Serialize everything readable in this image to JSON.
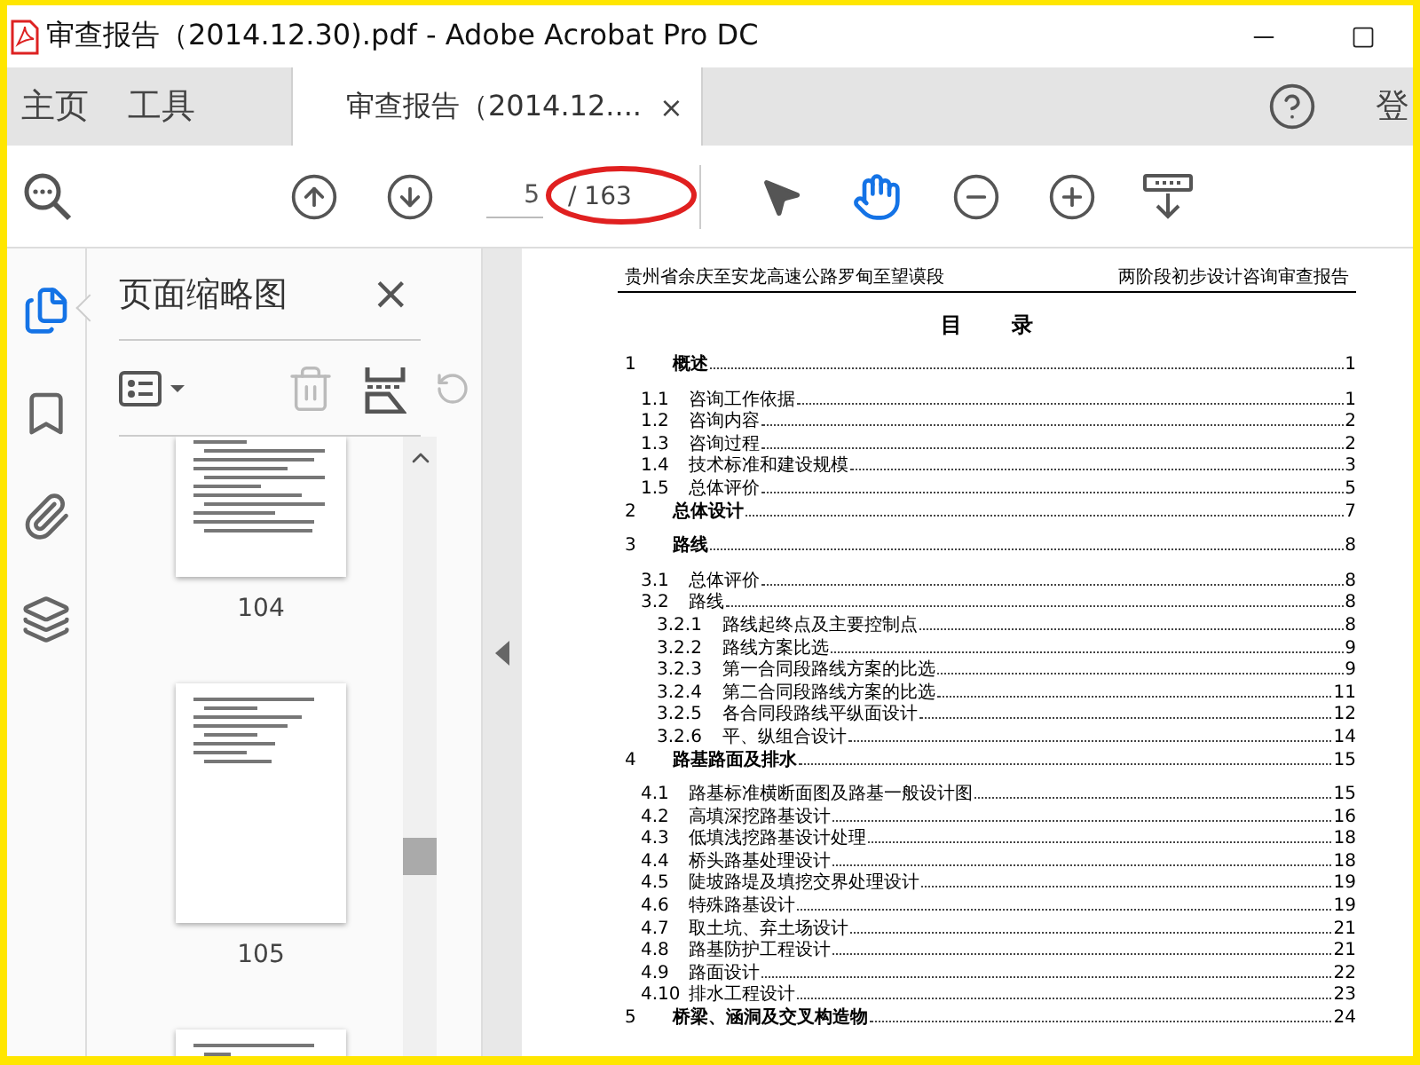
{
  "window": {
    "title": "审查报告（2014.12.30).pdf - Adobe Acrobat Pro DC"
  },
  "tabs": [
    {
      "label": "主页",
      "selected": false
    },
    {
      "label": "工具",
      "selected": false
    },
    {
      "label": "审查报告（2014.12....",
      "selected": true,
      "close": "×"
    }
  ],
  "account": {
    "label": "登"
  },
  "toolbar": {
    "page_value": "5",
    "page_total": "/ 163",
    "tools": [
      {
        "kind": "select",
        "selected": false
      },
      {
        "kind": "hand",
        "selected": true
      }
    ]
  },
  "rail": [
    {
      "kind": "pages",
      "selected": true
    },
    {
      "kind": "bookmarks",
      "selected": false
    },
    {
      "kind": "attachments",
      "selected": false
    },
    {
      "kind": "layers",
      "selected": false
    }
  ],
  "thumbnail_panel": {
    "title": "页面缩略图",
    "close": "×",
    "actions": [
      {
        "kind": "options",
        "disabled": false
      },
      {
        "kind": "delete",
        "disabled": true
      },
      {
        "kind": "insert",
        "disabled": false
      },
      {
        "kind": "rotate",
        "disabled": true
      }
    ],
    "thumbnails": [
      {
        "label": "104"
      },
      {
        "label": "105"
      }
    ]
  },
  "document": {
    "header_left": "贵州省余庆至安龙高速公路罗甸至望谟段",
    "header_right": "两阶段初步设计咨询审查报告",
    "title": "目 录",
    "toc": [
      {
        "number": "1",
        "title": "概述",
        "page": "1",
        "children": [
          {
            "number": "1.1",
            "title": "咨询工作依据",
            "page": "1"
          },
          {
            "number": "1.2",
            "title": "咨询内容",
            "page": "2"
          },
          {
            "number": "1.3",
            "title": "咨询过程",
            "page": "2"
          },
          {
            "number": "1.4",
            "title": "技术标准和建设规模",
            "page": "3"
          },
          {
            "number": "1.5",
            "title": "总体评价",
            "page": "5"
          }
        ]
      },
      {
        "number": "2",
        "title": "总体设计",
        "page": "7"
      },
      {
        "number": "3",
        "title": "路线",
        "page": "8",
        "children": [
          {
            "number": "3.1",
            "title": "总体评价",
            "page": "8"
          },
          {
            "number": "3.2",
            "title": "路线",
            "page": "8",
            "children": [
              {
                "number": "3.2.1",
                "title": "路线起终点及主要控制点",
                "page": "8"
              },
              {
                "number": "3.2.2",
                "title": "路线方案比选",
                "page": "9"
              },
              {
                "number": "3.2.3",
                "title": "第一合同段路线方案的比选",
                "page": "9"
              },
              {
                "number": "3.2.4",
                "title": "第二合同段路线方案的比选",
                "page": "11"
              },
              {
                "number": "3.2.5",
                "title": "各合同段路线平纵面设计",
                "page": "12"
              },
              {
                "number": "3.2.6",
                "title": "平、纵组合设计",
                "page": "14"
              }
            ]
          }
        ]
      },
      {
        "number": "4",
        "title": "路基路面及排水",
        "page": "15",
        "children": [
          {
            "number": "4.1",
            "title": "路基标准横断面图及路基一般设计图",
            "page": "15"
          },
          {
            "number": "4.2",
            "title": "高填深挖路基设计",
            "page": "16"
          },
          {
            "number": "4.3",
            "title": "低填浅挖路基设计处理",
            "page": "18"
          },
          {
            "number": "4.4",
            "title": "桥头路基处理设计",
            "page": "18"
          },
          {
            "number": "4.5",
            "title": "陡坡路堤及填挖交界处理设计",
            "page": "19"
          },
          {
            "number": "4.6",
            "title": "特殊路基设计",
            "page": "19"
          },
          {
            "number": "4.7",
            "title": "取土坑、弃土场设计",
            "page": "21"
          },
          {
            "number": "4.8",
            "title": "路基防护工程设计",
            "page": "21"
          },
          {
            "number": "4.9",
            "title": "路面设计",
            "page": "22"
          },
          {
            "number": "4.10",
            "title": "排水工程设计",
            "page": "23"
          }
        ]
      },
      {
        "number": "5",
        "title": "桥梁、涵洞及交叉构造物",
        "page": "24"
      }
    ]
  }
}
